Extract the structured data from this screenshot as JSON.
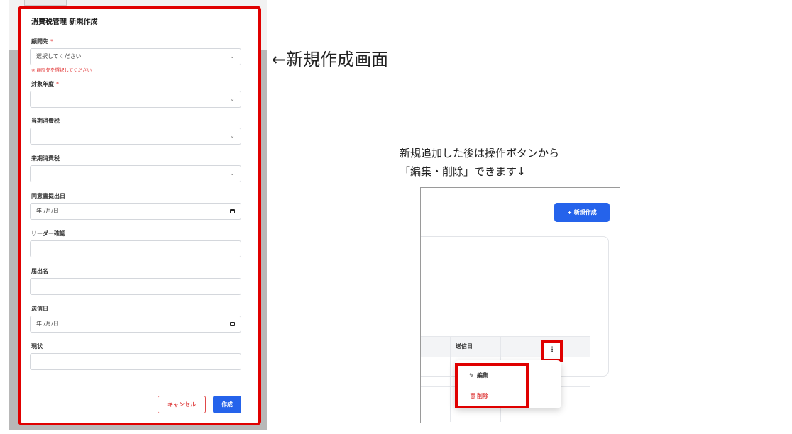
{
  "create_form": {
    "title": "消費税管理 新規作成",
    "fields": [
      {
        "label": "顧問先",
        "required": true,
        "type": "select",
        "value": "選択してください",
        "error": "※ 顧問先を選択してください"
      },
      {
        "label": "対象年度",
        "required": true,
        "type": "select",
        "value": ""
      },
      {
        "label": "当期消費税",
        "required": false,
        "type": "select",
        "value": ""
      },
      {
        "label": "来期消費税",
        "required": false,
        "type": "select",
        "value": ""
      },
      {
        "label": "同意書提出日",
        "required": false,
        "type": "date",
        "value": "年 /月/日"
      },
      {
        "label": "リーダー確認",
        "required": false,
        "type": "text",
        "value": ""
      },
      {
        "label": "届出名",
        "required": false,
        "type": "text",
        "value": ""
      },
      {
        "label": "送信日",
        "required": false,
        "type": "date",
        "value": "年 /月/日"
      },
      {
        "label": "現状",
        "required": false,
        "type": "text",
        "value": ""
      }
    ],
    "required_mark": "*",
    "cancel_label": "キャンセル",
    "create_label": "作成"
  },
  "annotations": {
    "main_note": "←新規作成画面",
    "sub_note_line1": "新規追加した後は操作ボタンから",
    "sub_note_line2": "「編集・削除」できます↓"
  },
  "list_view": {
    "new_button_label": "+ 新規作成",
    "column_header": "送信日",
    "kebab_glyph": "⋮",
    "menu": {
      "edit_label": "編集",
      "delete_label": "削除"
    }
  },
  "colors": {
    "primary": "#2563eb",
    "danger": "#e04848",
    "highlight": "#e00000"
  },
  "icons": {
    "chevron": "chevron-down-icon",
    "calendar": "calendar-icon",
    "kebab": "kebab-menu-icon",
    "edit": "edit-icon",
    "delete": "trash-icon"
  }
}
